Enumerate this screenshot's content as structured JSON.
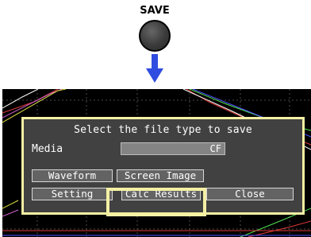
{
  "save_key": {
    "label": "SAVE"
  },
  "dialog": {
    "title": "Select the file type to save",
    "media_label": "Media",
    "media_value": "CF",
    "buttons": {
      "waveform": "Waveform",
      "screen_image": "Screen Image",
      "setting": "Setting",
      "calc_results": "Calc Results",
      "close": "Close"
    }
  },
  "colors": {
    "dialog_bg": "#414141",
    "dialog_border": "#f4f0a4",
    "arrow": "#2f4de0",
    "screen_bg": "#000000"
  },
  "icons": {
    "save_button": "round-black-key",
    "arrow": "down-arrow-icon"
  }
}
